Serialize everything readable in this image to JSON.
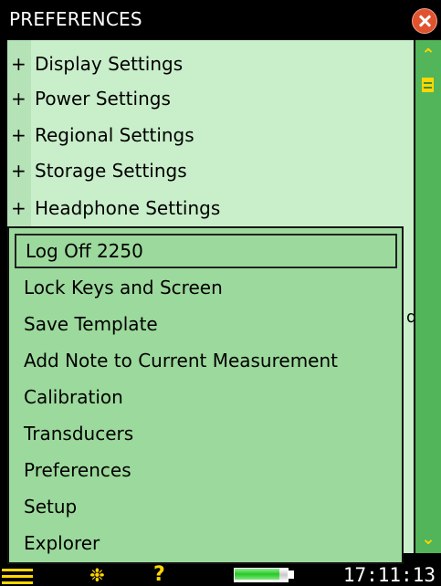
{
  "window": {
    "title": "PREFERENCES",
    "close_icon": "close-icon"
  },
  "tree": {
    "expand_symbol": "+",
    "items": [
      {
        "label": "Display Settings"
      },
      {
        "label": "Power Settings"
      },
      {
        "label": "Regional Settings"
      },
      {
        "label": "Storage Settings"
      },
      {
        "label": "Headphone Settings"
      }
    ]
  },
  "popup_menu": {
    "selected_index": 0,
    "items": [
      {
        "label": "Log Off 2250"
      },
      {
        "label": "Lock Keys and Screen"
      },
      {
        "label": "Save Template"
      },
      {
        "label": "Add Note to Current Measurement"
      },
      {
        "label": "Calibration"
      },
      {
        "label": "Transducers"
      },
      {
        "label": "Preferences"
      },
      {
        "label": "Setup"
      },
      {
        "label": "Explorer"
      }
    ]
  },
  "scrollbar": {
    "up_icon": "scroll-up-icon",
    "down_icon": "scroll-down-icon"
  },
  "status_bar": {
    "menu_icon": "menu-icon",
    "backlight_icon": "sun-icon",
    "help_icon": "help-icon",
    "help_glyph": "?",
    "battery_icon": "battery-icon",
    "battery_level": 0.85,
    "clock": "17:11:13"
  },
  "colors": {
    "main_bg": "#c9eeca",
    "popup_bg": "#9cd99c",
    "scrollbar": "#52b559",
    "accent_yellow": "#ffd700",
    "close_red": "#e0532f"
  }
}
